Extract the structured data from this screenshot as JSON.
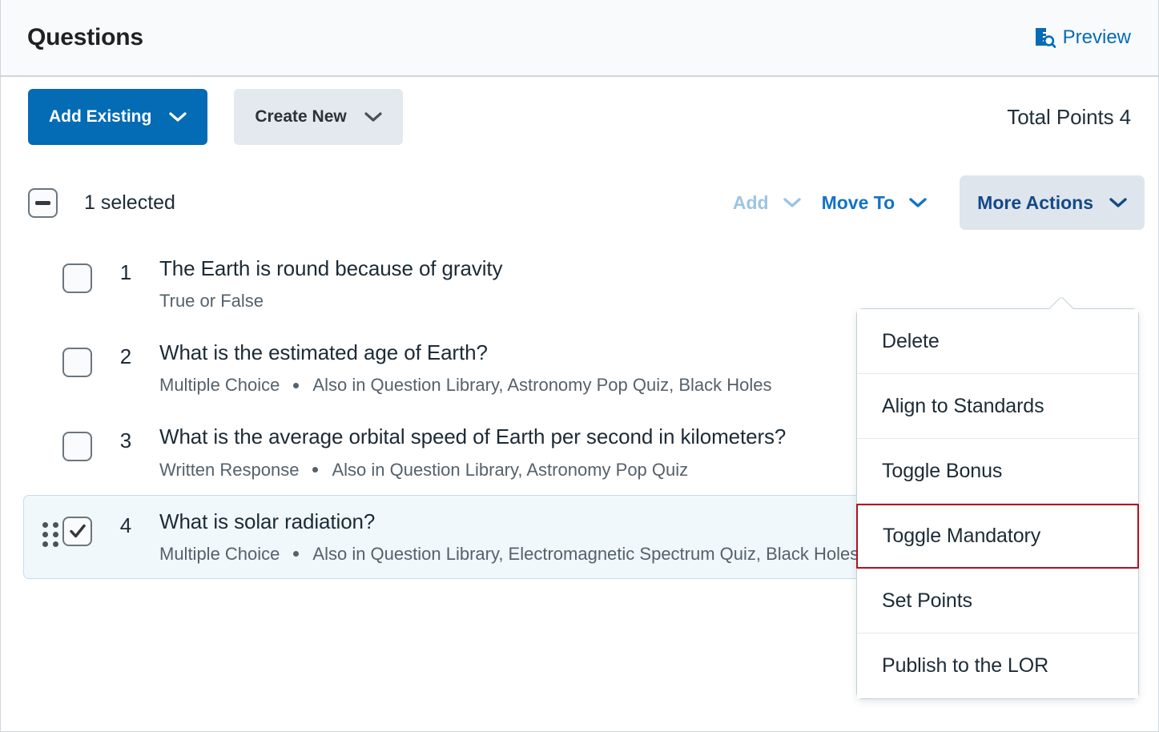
{
  "header": {
    "title": "Questions",
    "preview_label": "Preview",
    "preview_icon": "document-search-icon"
  },
  "toolbar": {
    "add_existing_label": "Add Existing",
    "create_new_label": "Create New",
    "total_points_label": "Total Points 4",
    "caret_icon": "chevron-down-icon"
  },
  "selection_bar": {
    "checkbox_state": "indeterminate",
    "selected_text": "1 selected",
    "add_label": "Add",
    "add_disabled": true,
    "move_to_label": "Move To",
    "more_actions_label": "More Actions"
  },
  "questions": [
    {
      "index": "1",
      "title": "The Earth is round because of gravity",
      "type": "True or False",
      "also_in": "",
      "selected": false,
      "checked": false
    },
    {
      "index": "2",
      "title": "What is the estimated age of Earth?",
      "type": "Multiple Choice",
      "also_in": "Also in Question Library, Astronomy Pop Quiz, Black Holes",
      "selected": false,
      "checked": false
    },
    {
      "index": "3",
      "title": "What is the average orbital speed of Earth per second in kilometers?",
      "type": "Written Response",
      "also_in": "Also in Question Library, Astronomy Pop Quiz",
      "selected": false,
      "checked": false
    },
    {
      "index": "4",
      "title": "What is solar radiation?",
      "type": "Multiple Choice",
      "also_in": "Also in Question Library, Electromagnetic Spectrum Quiz, Black Holes",
      "selected": true,
      "checked": true
    }
  ],
  "more_actions_menu": {
    "items": [
      {
        "label": "Delete",
        "highlighted": false
      },
      {
        "label": "Align to Standards",
        "highlighted": false
      },
      {
        "label": "Toggle Bonus",
        "highlighted": false
      },
      {
        "label": "Toggle Mandatory",
        "highlighted": true
      },
      {
        "label": "Set Points",
        "highlighted": false
      },
      {
        "label": "Publish to the LOR",
        "highlighted": false
      }
    ]
  },
  "colors": {
    "primary_blue": "#046bb5",
    "link_blue": "#1573c4",
    "disabled_blue": "#9cc4e4",
    "secondary_grey": "#e3e9ef",
    "more_actions_grey": "#dfe5ec",
    "highlight_red": "#b0121f",
    "selected_row_bg": "#f1f8fb",
    "header_bg": "#f8fafc"
  }
}
